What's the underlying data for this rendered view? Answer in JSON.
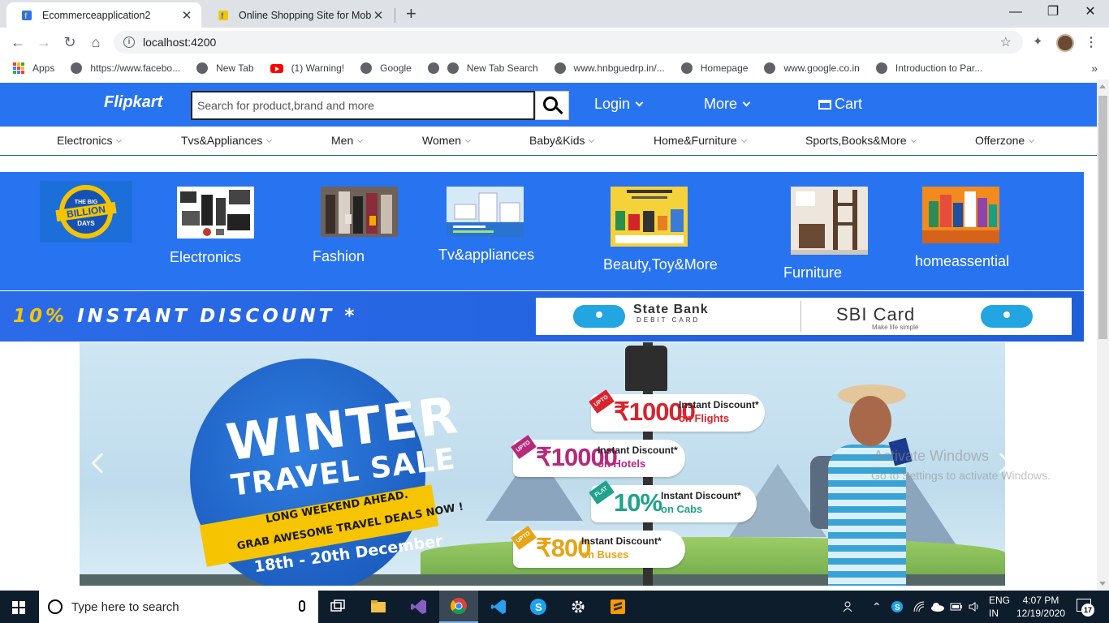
{
  "browser": {
    "tabs": [
      {
        "title": "Ecommerceapplication2",
        "close": "✕"
      },
      {
        "title": "Online Shopping Site for Mobiles",
        "close": "✕"
      }
    ],
    "new_tab": "+",
    "window_controls": {
      "minimize": "—",
      "maximize": "❐",
      "close": "✕"
    },
    "url": "localhost:4200",
    "bookmarks": [
      {
        "label": "Apps",
        "icon": "apps-grid-icon"
      },
      {
        "label": "https://www.facebo...",
        "icon": "globe-icon"
      },
      {
        "label": "New Tab",
        "icon": "globe-icon"
      },
      {
        "label": "(1) Warning!",
        "icon": "youtube-icon"
      },
      {
        "label": "Google",
        "icon": "globe-icon"
      },
      {
        "label": "",
        "icon": "globe-icon"
      },
      {
        "label": "New Tab Search",
        "icon": "globe-icon"
      },
      {
        "label": "www.hnbguedrp.in/...",
        "icon": "globe-icon"
      },
      {
        "label": "Homepage",
        "icon": "globe-icon"
      },
      {
        "label": "www.google.co.in",
        "icon": "globe-icon"
      },
      {
        "label": "Introduction to Par...",
        "icon": "globe-icon"
      }
    ],
    "bookmarks_more": "»"
  },
  "header": {
    "logo": "Flipkart",
    "search_placeholder": "Search for product,brand and more",
    "login": "Login",
    "more": "More",
    "cart": "Cart"
  },
  "categories": [
    "Electronics",
    "Tvs&Appliances",
    "Men",
    "Women",
    "Baby&Kids",
    "Home&Furniture",
    "Sports,Books&More",
    "Offerzone"
  ],
  "tiles": [
    {
      "label": "Electronics"
    },
    {
      "label": "Fashion"
    },
    {
      "label": "Tv&appliances"
    },
    {
      "label": "Beauty,Toy&More"
    },
    {
      "label": "Furniture"
    },
    {
      "label": "homeassential"
    }
  ],
  "big_billion": {
    "line1": "THE BIG",
    "line2": "BILLION",
    "line3": "DAYS"
  },
  "discount_banner": {
    "pct": "10%",
    "text": "INSTANT DISCOUNT *",
    "bank1": "State Bank",
    "bank1_sub": "DEBIT CARD",
    "bank2": "SBI Card",
    "bank2_sub": "Make life simple"
  },
  "carousel": {
    "title": "WINTER",
    "subtitle": "TRAVEL SALE",
    "ribbon1": "LONG WEEKEND AHEAD.",
    "ribbon2": "GRAB AWESOME TRAVEL DEALS NOW !",
    "dates": "18th - 20th December",
    "offers": [
      {
        "tag": "UPTO",
        "amount": "₹10000",
        "line1": "Instant Discount*",
        "line2": "on Flights",
        "color": "#d9232d"
      },
      {
        "tag": "UPTO",
        "amount": "₹10000",
        "line1": "Instant Discount*",
        "line2": "on Hotels",
        "color": "#b8297a"
      },
      {
        "tag": "FLAT",
        "amount": "10%",
        "line1": "Instant Discount*",
        "line2": "on Cabs",
        "color": "#1fa38a"
      },
      {
        "tag": "UPTO",
        "amount": "₹800",
        "line1": "Instant Discount*",
        "line2": "on Buses",
        "color": "#e6a417"
      }
    ]
  },
  "watermark": {
    "line1": "Activate Windows",
    "line2": "Go to Settings to activate Windows."
  },
  "taskbar": {
    "search_placeholder": "Type here to search",
    "lang1": "ENG",
    "lang2": "IN",
    "time": "4:07 PM",
    "date": "12/19/2020",
    "notif_count": "17"
  },
  "colors": {
    "brand": "#2874f0",
    "taskbar": "#0e1d2b"
  }
}
